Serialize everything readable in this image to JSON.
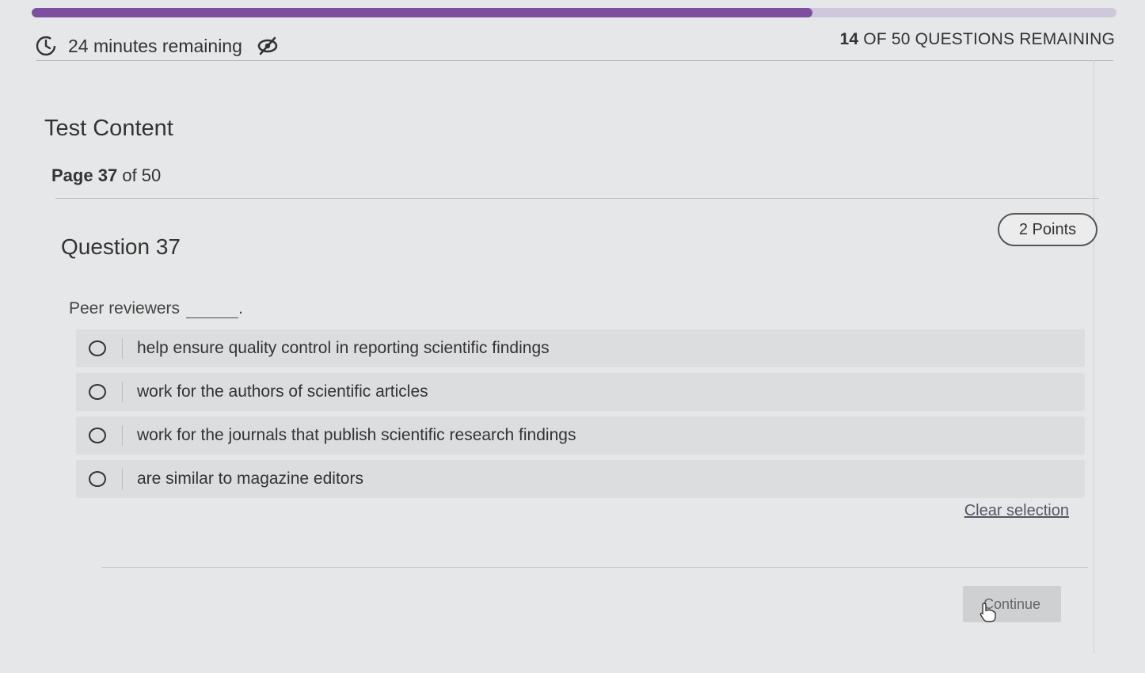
{
  "progress": {
    "percent_complete": 72
  },
  "header": {
    "timer_text": "24 minutes remaining",
    "remaining_count": "14",
    "remaining_suffix": "OF 50 QUESTIONS REMAINING"
  },
  "section": {
    "title": "Test Content"
  },
  "pagination": {
    "label": "Page",
    "current": "37",
    "of_text": "of 50"
  },
  "question": {
    "title": "Question 37",
    "points": "2 Points",
    "stem": "Peer reviewers",
    "stem_end": ".",
    "options": [
      {
        "text": "help ensure quality control in reporting scientific findings"
      },
      {
        "text": "work for the authors of scientific articles"
      },
      {
        "text": "work for the journals that publish scientific research findings"
      },
      {
        "text": "are similar to magazine editors"
      }
    ]
  },
  "actions": {
    "clear_label": "Clear selection",
    "continue_label": "Continue"
  },
  "colors": {
    "progress_fill": "#7d4f9e",
    "progress_track": "#cfc8da",
    "background": "#e6e7e8"
  }
}
